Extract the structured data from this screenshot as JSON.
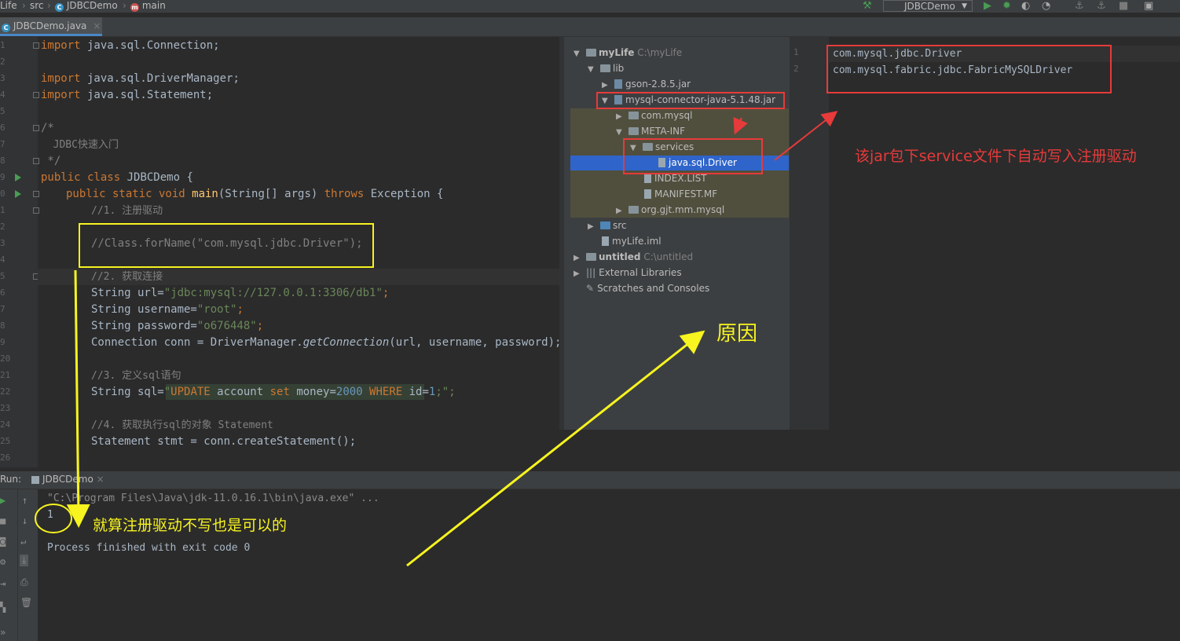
{
  "breadcrumb": {
    "project": "Life",
    "folder": "src",
    "cls": "JDBCDemo",
    "method": "main"
  },
  "run_config": "JDBCDemo",
  "editor_tab": "JDBCDemo.java",
  "gutter_numbers": [
    "1",
    "2",
    "3",
    "4",
    "5",
    "6",
    "7",
    "8",
    "9",
    "0",
    "1",
    "2",
    "3",
    "4",
    "5",
    "6",
    "7",
    "8",
    "9",
    "20",
    "21",
    "22",
    "23",
    "24",
    "25",
    "26"
  ],
  "code": {
    "l1_kw": "import",
    "l1_rest": " java.sql.Connection;",
    "l3_kw": "import",
    "l3_rest": " java.sql.DriverManager;",
    "l4_kw": "import",
    "l4_rest": " java.sql.Statement;",
    "l6": "/*",
    "l7": "  JDBC快速入门",
    "l8": " */",
    "l9_kw": "public class",
    "l9_rest": " JDBCDemo {",
    "l10_kw1": "public static void",
    "l10_fn": " main",
    "l10_a": "(String[] args) ",
    "l10_kw2": "throws",
    "l10_b": " Exception {",
    "l11": "//1. 注册驱动",
    "l13": "//Class.forName(\"com.mysql.jdbc.Driver\");",
    "l15": "//2. 获取连接",
    "l16_a": "String url=",
    "l16_s": "\"jdbc:mysql://127.0.0.1:3306/db1\"",
    "l16_b": ";",
    "l17_a": "String username=",
    "l17_s": "\"root\"",
    "l17_b": ";",
    "l18_a": "String password=",
    "l18_s": "\"o676448\"",
    "l18_b": ";",
    "l19_a": "Connection conn = DriverManager.",
    "l19_it": "getConnection",
    "l19_b": "(url, username, password);",
    "l21": "//3. 定义sql语句",
    "l22_a": "String sql=",
    "l22_q": "\"",
    "l22_k1": "UPDATE",
    "l22_t1": " account ",
    "l22_k2": "set",
    "l22_t2": " money=",
    "l22_n1": "2000",
    "l22_k3": " WHERE",
    "l22_t3": " id=",
    "l22_n2": "1",
    "l22_e": ";\";",
    "l24": "//4. 获取执行sql的对象 Statement",
    "l25": "Statement stmt = conn.createStatement();"
  },
  "project_tree": {
    "root": "myLife",
    "root_path": "C:\\myLife",
    "lib": "lib",
    "gson": "gson-2.8.5.jar",
    "mysql_jar": "mysql-connector-java-5.1.48.jar",
    "com_mysql": "com.mysql",
    "meta_inf": "META-INF",
    "services": "services",
    "driver_file": "java.sql.Driver",
    "index": "INDEX.LIST",
    "manifest": "MANIFEST.MF",
    "org": "org.gjt.mm.mysql",
    "src": "src",
    "iml": "myLife.iml",
    "untitled": "untitled",
    "untitled_path": "C:\\untitled",
    "ext": "External Libraries",
    "scratch": "Scratches and Consoles"
  },
  "file_viewer": {
    "line_numbers": [
      "1",
      "2"
    ],
    "lines": [
      "com.mysql.jdbc.Driver",
      "com.mysql.fabric.jdbc.FabricMySQLDriver"
    ]
  },
  "run": {
    "label": "Run:",
    "tab": "JDBCDemo",
    "cmd": "\"C:\\Program Files\\Java\\jdk-11.0.16.1\\bin\\java.exe\" ...",
    "output": "1",
    "finished": "Process finished with exit code 0"
  },
  "annotations": {
    "jar_note": "该jar包下service文件下自动写入注册驱动",
    "reason": "原因",
    "skip_note": "就算注册驱动不写也是可以的"
  },
  "colors": {
    "annotation_yellow": "#f7f41f",
    "annotation_red": "#e73a3a",
    "selection": "#2f65ca"
  }
}
